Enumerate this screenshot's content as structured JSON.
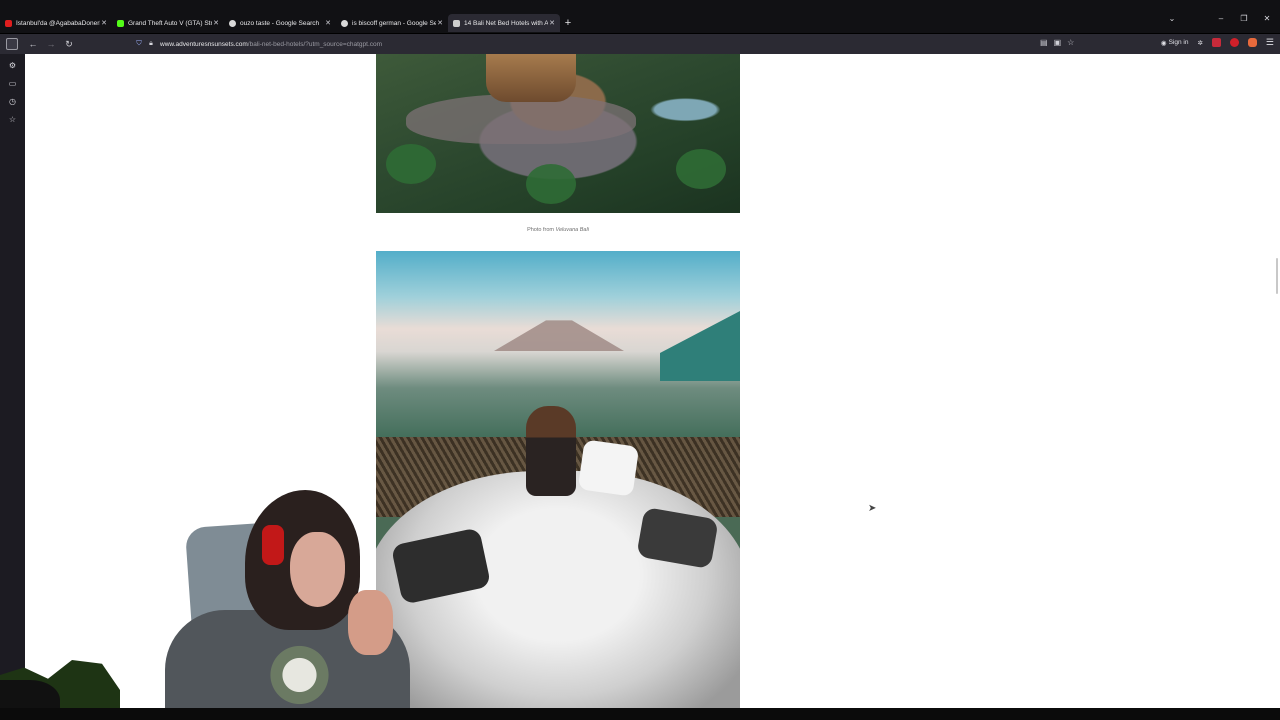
{
  "tabs": [
    {
      "label": "İstanbul'da @AgababaDonerR",
      "favicon_color": "#e01e1e",
      "active": false
    },
    {
      "label": "Grand Theft Auto V (GTA) Stre",
      "favicon_color": "#53fc18",
      "active": false
    },
    {
      "label": "ouzo taste - Google Search",
      "favicon_color": "#d9d9d9",
      "active": false
    },
    {
      "label": "is biscoff german - Google Sea",
      "favicon_color": "#d9d9d9",
      "active": false
    },
    {
      "label": "14 Bali Net Bed Hotels with Am",
      "favicon_color": "#cfcfcf",
      "active": true
    }
  ],
  "toolbar": {
    "new_tab": "+",
    "list_all_tabs": "⌄",
    "minimize": "–",
    "restore": "❐",
    "close": "✕",
    "back": "←",
    "forward": "→",
    "reload": "↻"
  },
  "urlbar": {
    "domain": "www.adventuresnsunsets.com",
    "path": "/bali-net-bed-hotels/?utm_source=chatgpt.com"
  },
  "account": {
    "sign_in": "Sign in"
  },
  "article": {
    "photo1_caption_prefix": "Photo from ",
    "photo1_caption_source": "Veluvana Bali"
  },
  "icons": {
    "reader": "reader-view-icon",
    "screenshot": "screenshot-icon",
    "bookmark": "bookmark-star-icon",
    "account": "account-icon",
    "extensions": "extensions-icon",
    "menu": "hamburger-menu-icon"
  }
}
